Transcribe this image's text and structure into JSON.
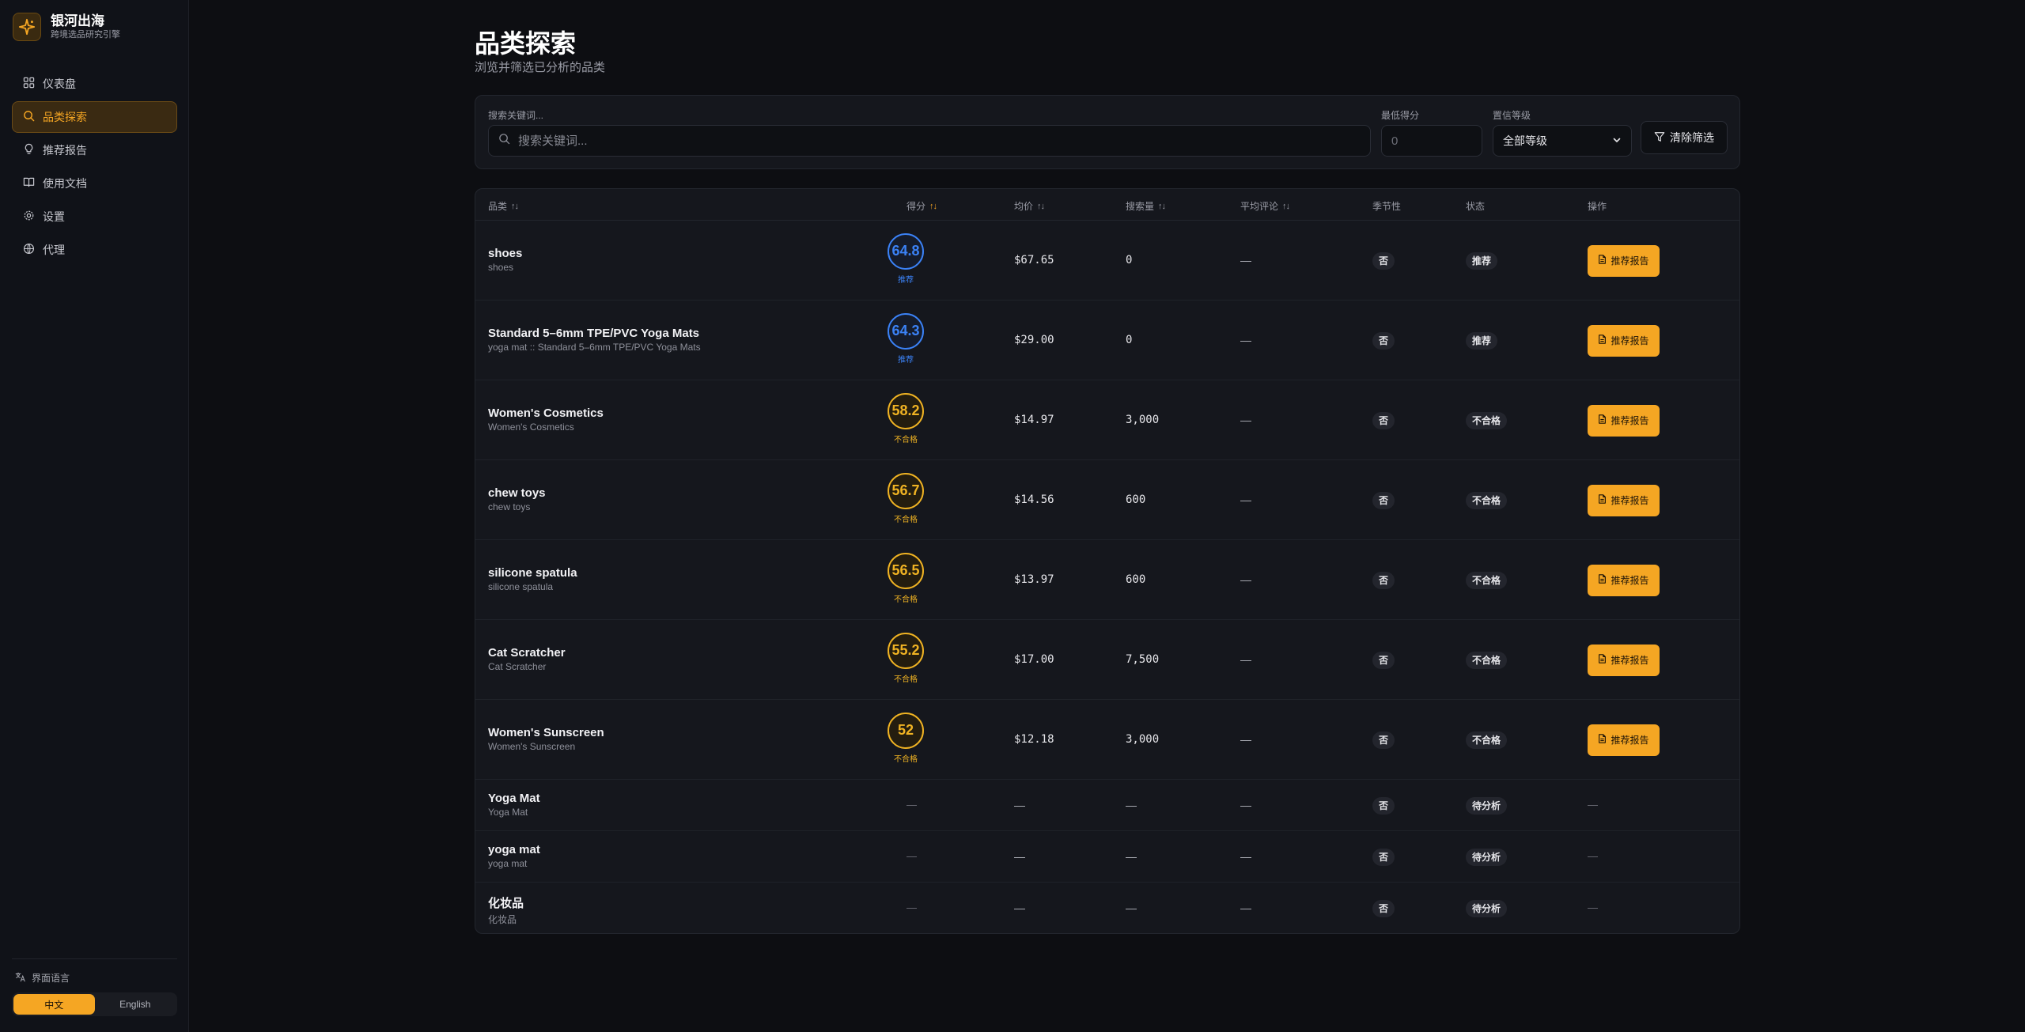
{
  "brand": {
    "name": "银河出海",
    "subtitle": "跨境选品研究引擎"
  },
  "nav": [
    {
      "label": "仪表盘",
      "icon": "grid-icon",
      "active": false
    },
    {
      "label": "品类探索",
      "icon": "search-icon",
      "active": true
    },
    {
      "label": "推荐报告",
      "icon": "lightbulb-icon",
      "active": false
    },
    {
      "label": "使用文档",
      "icon": "book-icon",
      "active": false
    },
    {
      "label": "设置",
      "icon": "gear-icon",
      "active": false
    },
    {
      "label": "代理",
      "icon": "globe-icon",
      "active": false
    }
  ],
  "language": {
    "title": "界面语言",
    "options": [
      "中文",
      "English"
    ],
    "selected": "中文"
  },
  "page": {
    "title": "品类探索",
    "subtitle": "浏览并筛选已分析的品类"
  },
  "filters": {
    "search_label": "搜索关键词...",
    "search_placeholder": "搜索关键词...",
    "min_score_label": "最低得分",
    "min_score_placeholder": "0",
    "level_label": "置信等级",
    "level_value": "全部等级",
    "clear_label": "清除筛选"
  },
  "table": {
    "columns": [
      "品类",
      "得分",
      "均价",
      "搜索量",
      "平均评论",
      "季节性",
      "状态",
      "操作"
    ],
    "action_label": "推荐报告",
    "rows": [
      {
        "name": "shoes",
        "sub": "shoes",
        "score": "64.8",
        "score_tag": "推荐",
        "price": "$67.65",
        "search": "0",
        "reviews": "—",
        "seasonal": "否",
        "status": "推荐"
      },
      {
        "name": "Standard 5–6mm TPE/PVC Yoga Mats",
        "sub": "yoga mat :: Standard 5–6mm TPE/PVC Yoga Mats",
        "score": "64.3",
        "score_tag": "推荐",
        "price": "$29.00",
        "search": "0",
        "reviews": "—",
        "seasonal": "否",
        "status": "推荐"
      },
      {
        "name": "Women's Cosmetics",
        "sub": "Women's Cosmetics",
        "score": "58.2",
        "score_tag": "不合格",
        "price": "$14.97",
        "search": "3,000",
        "reviews": "—",
        "seasonal": "否",
        "status": "不合格"
      },
      {
        "name": "chew toys",
        "sub": "chew toys",
        "score": "56.7",
        "score_tag": "不合格",
        "price": "$14.56",
        "search": "600",
        "reviews": "—",
        "seasonal": "否",
        "status": "不合格"
      },
      {
        "name": "silicone spatula",
        "sub": "silicone spatula",
        "score": "56.5",
        "score_tag": "不合格",
        "price": "$13.97",
        "search": "600",
        "reviews": "—",
        "seasonal": "否",
        "status": "不合格"
      },
      {
        "name": "Cat Scratcher",
        "sub": "Cat Scratcher",
        "score": "55.2",
        "score_tag": "不合格",
        "price": "$17.00",
        "search": "7,500",
        "reviews": "—",
        "seasonal": "否",
        "status": "不合格"
      },
      {
        "name": "Women's Sunscreen",
        "sub": "Women's Sunscreen",
        "score": "52",
        "score_tag": "不合格",
        "price": "$12.18",
        "search": "3,000",
        "reviews": "—",
        "seasonal": "否",
        "status": "不合格"
      },
      {
        "name": "Yoga Mat",
        "sub": "Yoga Mat",
        "score": "—",
        "price": "—",
        "search": "—",
        "reviews": "—",
        "seasonal": "否",
        "status": "待分析",
        "action": "—"
      },
      {
        "name": "yoga mat",
        "sub": "yoga mat",
        "score": "—",
        "price": "—",
        "search": "—",
        "reviews": "—",
        "seasonal": "否",
        "status": "待分析",
        "action": "—"
      },
      {
        "name": "化妆品",
        "sub": "化妆品",
        "score": "—",
        "price": "—",
        "search": "—",
        "reviews": "—",
        "seasonal": "否",
        "status": "待分析",
        "action": "—"
      }
    ]
  },
  "colors": {
    "accent": "#f5a623",
    "recommend": "#3b82f6",
    "fail": "#f0b323"
  }
}
